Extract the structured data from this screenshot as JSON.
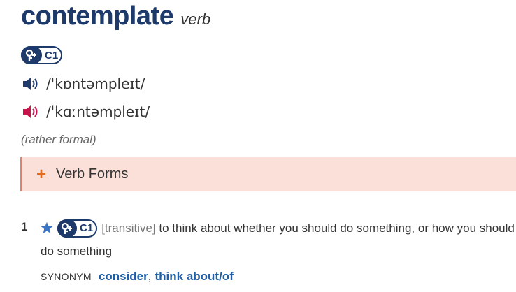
{
  "entry": {
    "headword": "contemplate",
    "part_of_speech": "verb",
    "level": "C1",
    "pronunciations": [
      {
        "ipa": "/ˈkɒntəmpleɪt/",
        "icon": "speaker-icon",
        "color": "#1d3a6b"
      },
      {
        "ipa": "/ˈkɑːntəmpleɪt/",
        "icon": "speaker-icon",
        "color": "#c8164c"
      }
    ],
    "register": "(rather formal)"
  },
  "verb_forms": {
    "toggle_symbol": "+",
    "label": "Verb Forms"
  },
  "senses": [
    {
      "number": "1",
      "level": "C1",
      "grammar": "[transitive]",
      "definition": "to think about whether you should do something, or how you should do something",
      "synonym_label": "SYNONYM",
      "synonyms": [
        "consider",
        "think about/of"
      ],
      "separator": ","
    }
  ],
  "colors": {
    "headword": "#1d3a6b",
    "verb_forms_bg": "#fbdfd9",
    "verb_forms_border": "#e0826e",
    "plus": "#e06b1f",
    "link": "#1f5fa8",
    "star": "#3a74c4"
  }
}
